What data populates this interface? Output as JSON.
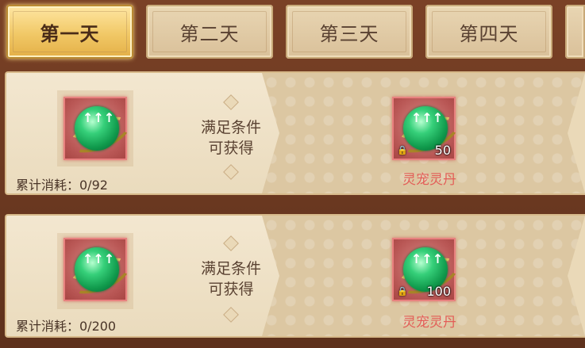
{
  "tabs": [
    {
      "label": "第一天",
      "active": true
    },
    {
      "label": "第二天",
      "active": false
    },
    {
      "label": "第三天",
      "active": false
    },
    {
      "label": "第四天",
      "active": false
    }
  ],
  "rows": [
    {
      "condition_item_icon": "spirit-pill-icon",
      "condition_text_1": "满足条件",
      "condition_text_2": "可获得",
      "progress_label": "累计消耗：0/92",
      "progress_current": 0,
      "progress_target": 92,
      "reward_icon": "spirit-pill-icon",
      "reward_count": "50",
      "reward_name": "灵宠灵丹",
      "reward_locked": true
    },
    {
      "condition_item_icon": "spirit-pill-icon",
      "condition_text_1": "满足条件",
      "condition_text_2": "可获得",
      "progress_label": "累计消耗：0/200",
      "progress_current": 0,
      "progress_target": 200,
      "reward_icon": "spirit-pill-icon",
      "reward_count": "100",
      "reward_name": "灵宠灵丹",
      "reward_locked": true
    }
  ],
  "colors": {
    "active_tab": "#f1c866",
    "reward_name": "#e35d57",
    "frame": "#6b3a22"
  }
}
